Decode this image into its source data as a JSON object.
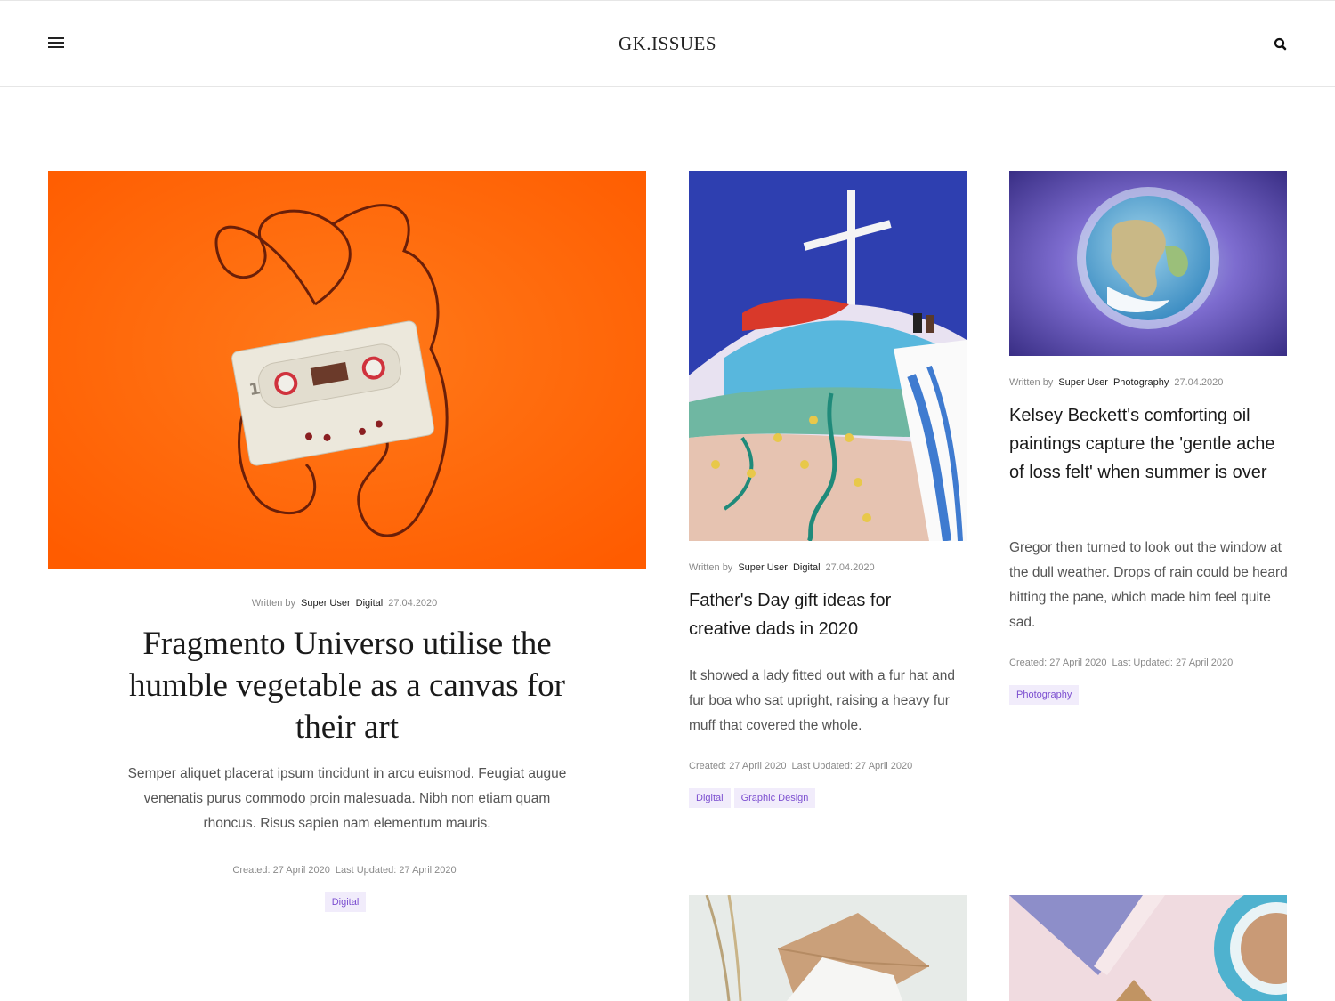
{
  "header": {
    "logo": "GK.ISSUES"
  },
  "icons": {
    "menu": "hamburger-icon",
    "search": "search-icon"
  },
  "colors": {
    "tag_bg": "#f1ecfb",
    "tag_text": "#7c4fd0",
    "hero_bg": "#ff6a0e"
  },
  "articles": [
    {
      "written_by": "Written by",
      "author": "Super User",
      "category": "Digital",
      "date": "27.04.2020",
      "title": "Fragmento Universo utilise the humble vegetable as a canvas for their art",
      "excerpt": "Semper aliquet placerat ipsum tincidunt in arcu euismod. Feugiat augue venenatis purus commodo proin malesuada. Nibh non etiam quam rhoncus. Risus sapien nam elementum mauris.",
      "created": "Created: 27 April 2020",
      "updated": "Last Updated: 27 April 2020",
      "tags": [
        "Digital"
      ]
    },
    {
      "written_by": "Written by",
      "author": "Super User",
      "category": "Digital",
      "date": "27.04.2020",
      "title": "Father's Day gift ideas for creative dads in 2020",
      "excerpt": "It showed a lady fitted out with a fur hat and fur boa who sat upright, raising a heavy fur muff that covered the whole.",
      "created": "Created: 27 April 2020",
      "updated": "Last Updated: 27 April 2020",
      "tags": [
        "Digital",
        "Graphic Design"
      ]
    },
    {
      "written_by": "Written by",
      "author": "Super User",
      "category": "Photography",
      "date": "27.04.2020",
      "title": "Kelsey Beckett's comforting oil paintings capture the 'gentle ache of loss felt' when summer is over",
      "excerpt": "Gregor then turned to look out the window at the dull weather. Drops of rain could be heard hitting the pane, which made him feel quite sad.",
      "created": "Created: 27 April 2020",
      "updated": "Last Updated: 27 April 2020",
      "tags": [
        "Photography"
      ]
    }
  ]
}
